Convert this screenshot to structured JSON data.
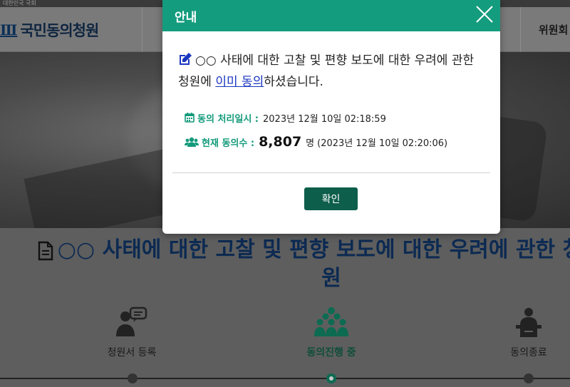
{
  "header": {
    "top_strip_text": "대한민국 국회",
    "logo_mark": "Ⅲ",
    "site_title": "국민동의청원",
    "right_menu_item": "위원회"
  },
  "petition": {
    "title_line1": "○○ 사태에 대한 고찰 및 편향 보도에 대한 우려에 관한 청",
    "title_line2": "원"
  },
  "steps": [
    {
      "label": "청원서 등록",
      "icon": "speech-person-icon",
      "active": false
    },
    {
      "label": "동의진행 중",
      "icon": "people-group-icon",
      "active": true
    },
    {
      "label": "동의종료",
      "icon": "podium-person-icon",
      "active": false
    }
  ],
  "modal": {
    "title": "안내",
    "message_prefix": "○○ 사태에 대한 고찰 및 편향 보도에 대한 우려에 관한 청원에 ",
    "message_link": "이미 동의",
    "message_suffix": "하셨습니다.",
    "processed_label": "동의 처리일시 :",
    "processed_value": "2023년 12월 10일 02:18:59",
    "count_label": "현재 동의수 :",
    "count_value": "8,807",
    "count_unit": "명",
    "count_timestamp": "(2023년 12월 10일 02:20:06)",
    "confirm_label": "확인"
  },
  "colors": {
    "modal_header": "#149c7e",
    "confirm_button": "#0d5e4b",
    "accent_text": "#129a7a",
    "link": "#1a36c0"
  }
}
